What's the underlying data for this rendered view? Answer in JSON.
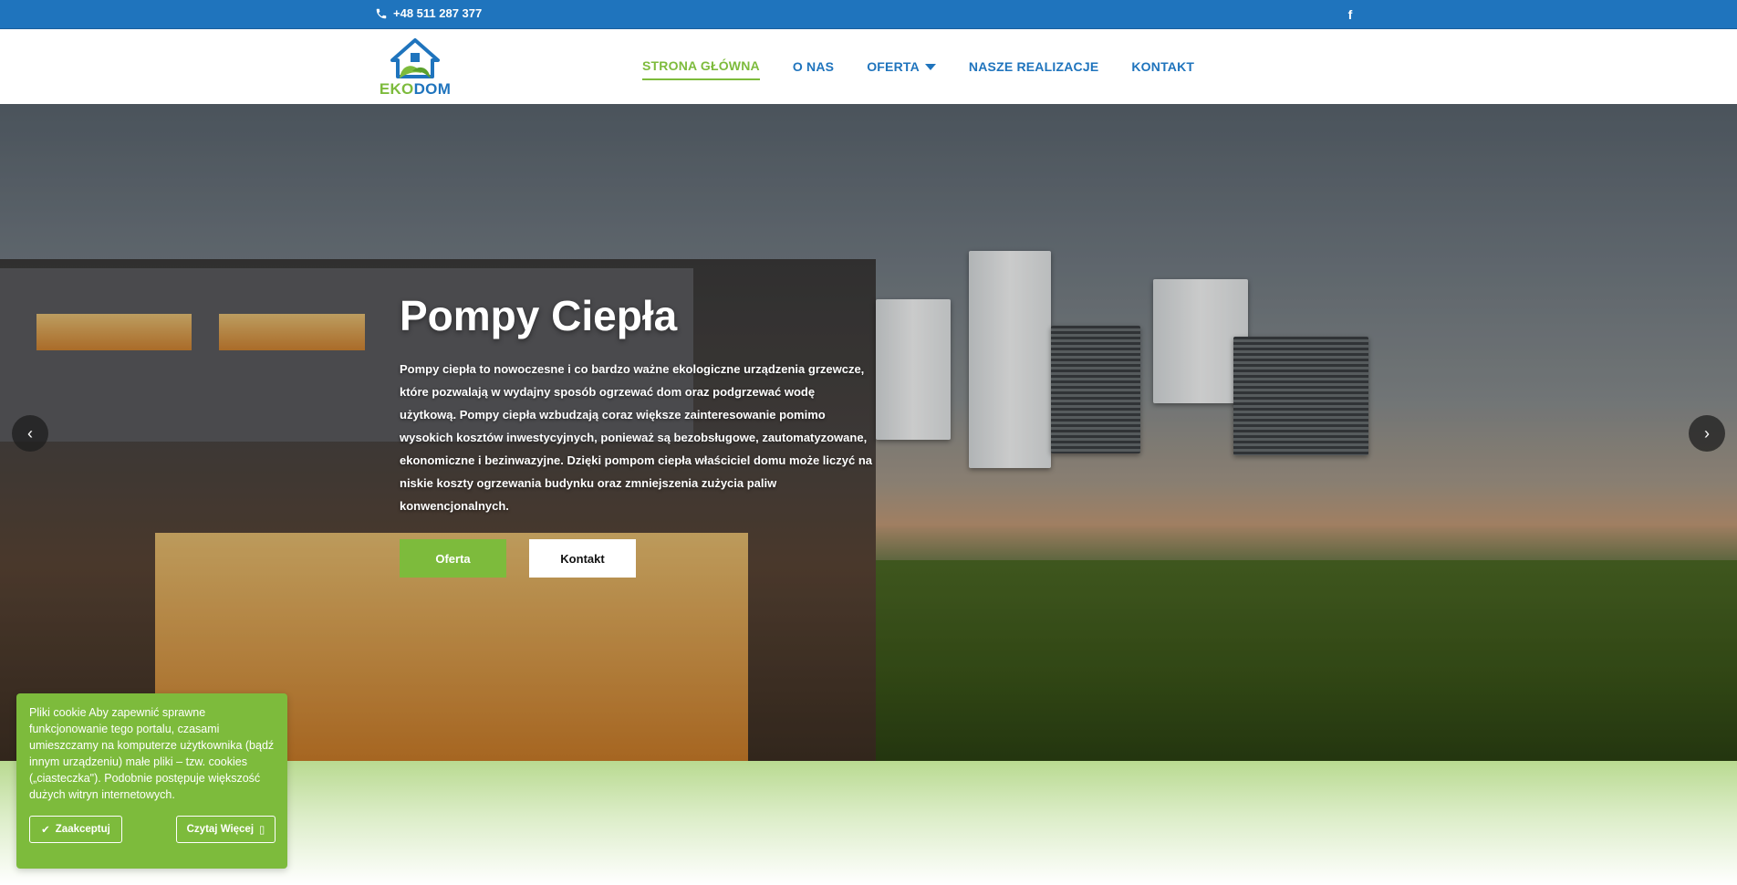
{
  "topbar": {
    "phone": "+48 511 287 377",
    "social_label": "f"
  },
  "logo": {
    "part1": "EKO",
    "part2": "DOM"
  },
  "nav": {
    "items": [
      {
        "label": "STRONA GŁÓWNA"
      },
      {
        "label": "O NAS"
      },
      {
        "label": "OFERTA"
      },
      {
        "label": "NASZE REALIZACJE"
      },
      {
        "label": "KONTAKT"
      }
    ]
  },
  "hero": {
    "title": "Pompy Ciepła",
    "text": "Pompy ciepła to nowoczesne i co bardzo ważne ekologiczne urządzenia grzewcze, które pozwalają w wydajny sposób ogrzewać dom oraz podgrzewać wodę użytkową. Pompy ciepła wzbudzają coraz większe zainteresowanie pomimo wysokich kosztów inwestycyjnych, ponieważ są bezobsługowe, zautomatyzowane, ekonomiczne i bezinwazyjne. Dzięki pompom ciepła właściciel domu może liczyć na niskie koszty ogrzewania budynku oraz zmniejszenia zużycia paliw konwencjonalnych.",
    "btn_primary": "Oferta",
    "btn_secondary": "Kontakt",
    "arrow_left": "‹",
    "arrow_right": "›"
  },
  "cookie": {
    "text": "Pliki cookie Aby zapewnić sprawne funkcjonowanie tego portalu, czasami umieszczamy na komputerze użytkownika (bądź innym urządzeniu) małe pliki – tzw. cookies („ciasteczka\"). Podobnie postępuje większość dużych witryn internetowych.",
    "accept": "Zaakceptuj",
    "more": "Czytaj Więcej"
  },
  "colors": {
    "brand_blue": "#1f74bd",
    "brand_green": "#7dbb3c"
  }
}
